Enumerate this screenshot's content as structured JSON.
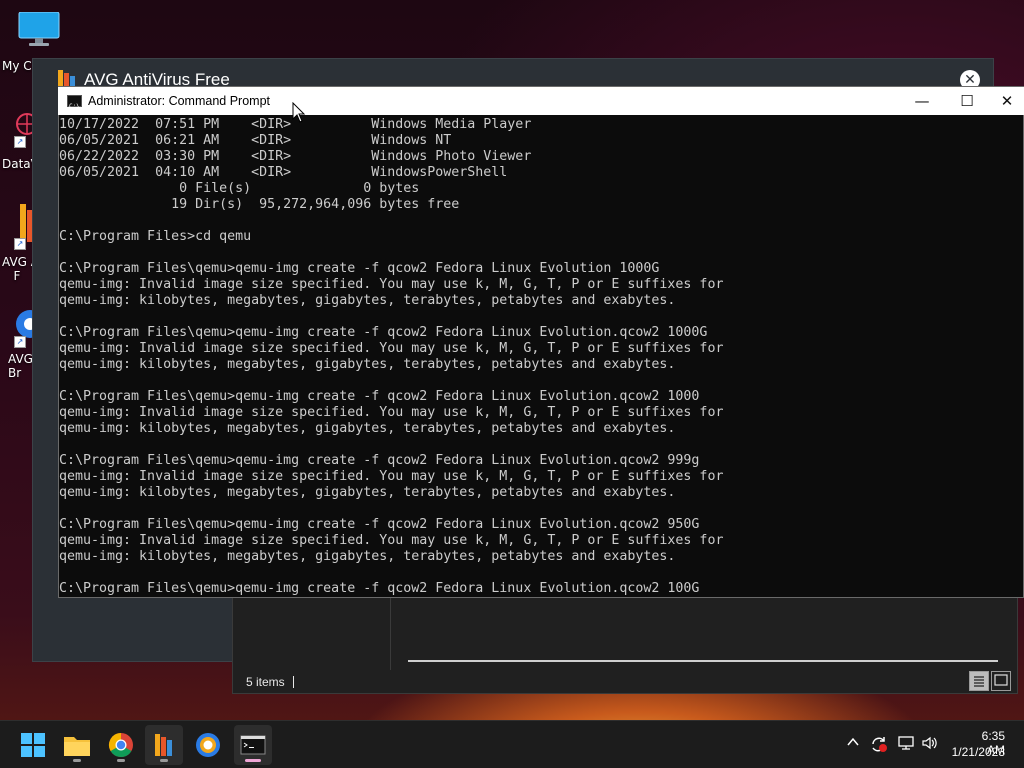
{
  "desktop": {
    "icons": [
      {
        "label": "My C"
      },
      {
        "label": "DataV"
      },
      {
        "label": "AVG A\n   F"
      },
      {
        "label": "AVG\nBr"
      }
    ]
  },
  "avg_window": {
    "title": "AVG AntiVirus Free",
    "close_label": "✕"
  },
  "explorer": {
    "status": "5 items"
  },
  "cmd": {
    "title": "Administrator: Command Prompt",
    "buttons": {
      "minimize": "—",
      "maximize": "☐",
      "close": "✕"
    },
    "lines": [
      "10/17/2022  07:51 PM    <DIR>          Windows Media Player",
      "06/05/2021  06:21 AM    <DIR>          Windows NT",
      "06/22/2022  03:30 PM    <DIR>          Windows Photo Viewer",
      "06/05/2021  04:10 AM    <DIR>          WindowsPowerShell",
      "               0 File(s)              0 bytes",
      "              19 Dir(s)  95,272,964,096 bytes free",
      "",
      "C:\\Program Files>cd qemu",
      "",
      "C:\\Program Files\\qemu>qemu-img create -f qcow2 Fedora Linux Evolution 1000G",
      "qemu-img: Invalid image size specified. You may use k, M, G, T, P or E suffixes for",
      "qemu-img: kilobytes, megabytes, gigabytes, terabytes, petabytes and exabytes.",
      "",
      "C:\\Program Files\\qemu>qemu-img create -f qcow2 Fedora Linux Evolution.qcow2 1000G",
      "qemu-img: Invalid image size specified. You may use k, M, G, T, P or E suffixes for",
      "qemu-img: kilobytes, megabytes, gigabytes, terabytes, petabytes and exabytes.",
      "",
      "C:\\Program Files\\qemu>qemu-img create -f qcow2 Fedora Linux Evolution.qcow2 1000",
      "qemu-img: Invalid image size specified. You may use k, M, G, T, P or E suffixes for",
      "qemu-img: kilobytes, megabytes, gigabytes, terabytes, petabytes and exabytes.",
      "",
      "C:\\Program Files\\qemu>qemu-img create -f qcow2 Fedora Linux Evolution.qcow2 999g",
      "qemu-img: Invalid image size specified. You may use k, M, G, T, P or E suffixes for",
      "qemu-img: kilobytes, megabytes, gigabytes, terabytes, petabytes and exabytes.",
      "",
      "C:\\Program Files\\qemu>qemu-img create -f qcow2 Fedora Linux Evolution.qcow2 950G",
      "qemu-img: Invalid image size specified. You may use k, M, G, T, P or E suffixes for",
      "qemu-img: kilobytes, megabytes, gigabytes, terabytes, petabytes and exabytes.",
      "",
      "C:\\Program Files\\qemu>qemu-img create -f qcow2 Fedora Linux Evolution.qcow2 100G"
    ]
  },
  "taskbar": {
    "apps": [
      "start-icon",
      "file-explorer-icon",
      "chrome-icon",
      "avg-antivirus-icon",
      "avg-secure-browser-icon",
      "command-prompt-icon"
    ],
    "tray": {
      "chevron": "∧",
      "network": "🖧",
      "volume": "🔊"
    },
    "clock": {
      "time": "6:35 AM",
      "date": "1/21/2023"
    }
  }
}
